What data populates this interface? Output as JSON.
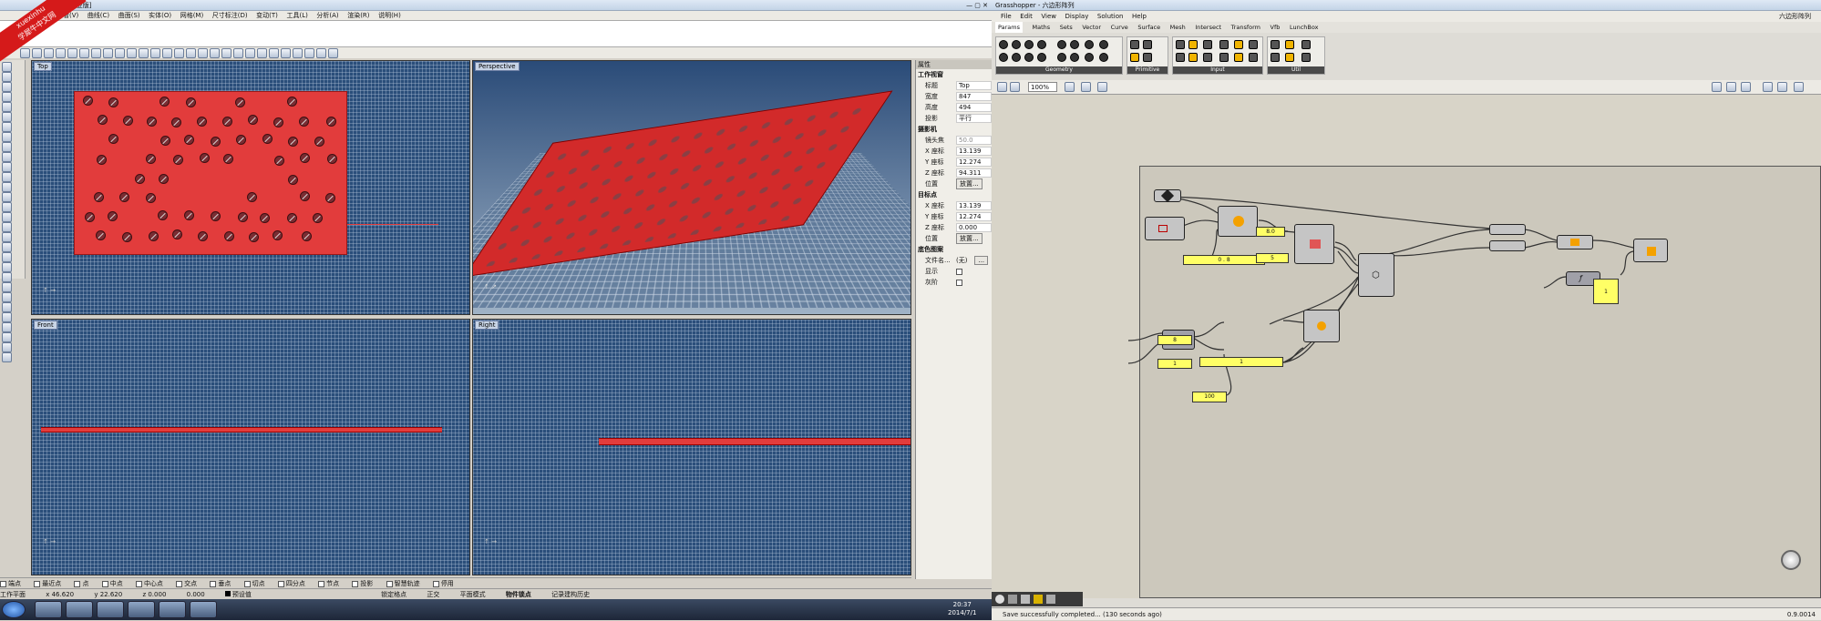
{
  "rhino": {
    "title": "[商业版]",
    "menu": [
      "查看(V)",
      "曲线(C)",
      "曲面(S)",
      "实体(O)",
      "网格(M)",
      "尺寸标注(D)",
      "变动(T)",
      "工具(L)",
      "分析(A)",
      "渲染(R)",
      "说明(H)"
    ],
    "viewports": {
      "top": "Top",
      "perspective": "Perspective",
      "front": "Front",
      "right": "Right"
    },
    "properties": {
      "title": "属性",
      "sec_viewport": "工作视窗",
      "rows1": [
        {
          "k": "标题",
          "v": "Top"
        },
        {
          "k": "宽度",
          "v": "847"
        },
        {
          "k": "高度",
          "v": "494"
        },
        {
          "k": "投影",
          "v": "平行"
        }
      ],
      "sec_camera": "摄影机",
      "rows2": [
        {
          "k": "镜头焦",
          "v": "50.0"
        },
        {
          "k": "X 座标",
          "v": "13.139"
        },
        {
          "k": "Y 座标",
          "v": "12.274"
        },
        {
          "k": "Z 座标",
          "v": "94.311"
        }
      ],
      "place1_k": "位置",
      "place_btn": "放置...",
      "sec_target": "目标点",
      "rows3": [
        {
          "k": "X 座标",
          "v": "13.139"
        },
        {
          "k": "Y 座标",
          "v": "12.274"
        },
        {
          "k": "Z 座标",
          "v": "0.000"
        }
      ],
      "place2_k": "位置",
      "sec_bg": "底色图案",
      "file_k": "文件名...",
      "file_v": "(无)",
      "show_k": "显示",
      "gray_k": "灰阶"
    },
    "osnap": [
      "端点",
      "最近点",
      "点",
      "中点",
      "中心点",
      "交点",
      "垂点",
      "切点",
      "四分点",
      "节点",
      "投影",
      "智慧轨迹",
      "停用"
    ],
    "status": [
      "工作平面",
      "x 46.620",
      "y 22.620",
      "z 0.000",
      "0.000",
      "预设值",
      "锁定格点",
      "正交",
      "平面模式",
      "物件锁点",
      "记录建构历史"
    ],
    "clock": {
      "time": "20:37",
      "date": "2014/7/1"
    }
  },
  "gh": {
    "title": "Grasshopper - 六边形阵列",
    "doc_name": "六边形阵列",
    "menu": [
      "File",
      "Edit",
      "View",
      "Display",
      "Solution",
      "Help"
    ],
    "tabs": [
      "Params",
      "Maths",
      "Sets",
      "Vector",
      "Curve",
      "Surface",
      "Mesh",
      "Intersect",
      "Transform",
      "Vfb",
      "LunchBox"
    ],
    "groups": [
      "Geometry",
      "Primitive",
      "Input",
      "Util"
    ],
    "zoom": "100%",
    "status_msg": "Save successfully completed... (130 seconds ago)",
    "version": "0.9.0014",
    "panels": [
      {
        "id": "p1",
        "text": "0 . 8"
      },
      {
        "id": "p2",
        "text": "8.0"
      },
      {
        "id": "p3",
        "text": "5"
      },
      {
        "id": "p4",
        "text": "8"
      },
      {
        "id": "p5",
        "text": "1"
      },
      {
        "id": "p6",
        "text": "1"
      },
      {
        "id": "p7",
        "text": "100"
      },
      {
        "id": "p8",
        "text": "1"
      }
    ]
  },
  "watermark": {
    "line1": "xuexinhu",
    "line2": "学犀牛中文网"
  }
}
